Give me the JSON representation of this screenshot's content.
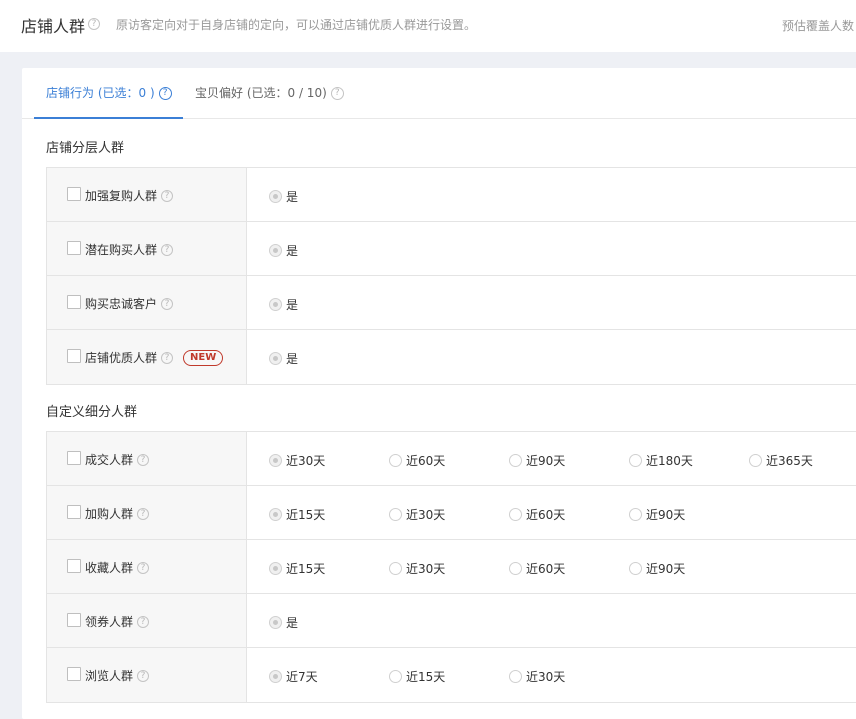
{
  "header": {
    "title": "店铺人群",
    "description": "原访客定向对于自身店铺的定向，可以通过店铺优质人群进行设置。",
    "right_text": "预估覆盖人数"
  },
  "tabs": [
    {
      "label": "店铺行为 (已选：0 )",
      "active": true
    },
    {
      "label": "宝贝偏好 (已选：0 / 10)",
      "active": false
    }
  ],
  "section1": {
    "title": "店铺分层人群",
    "rows": [
      {
        "label": "加强复购人群",
        "badge": "",
        "options": [
          "是"
        ]
      },
      {
        "label": "潜在购买人群",
        "badge": "",
        "options": [
          "是"
        ]
      },
      {
        "label": "购买忠诚客户",
        "badge": "",
        "options": [
          "是"
        ]
      },
      {
        "label": "店铺优质人群",
        "badge": "NEW",
        "options": [
          "是"
        ]
      }
    ]
  },
  "section2": {
    "title": "自定义细分人群",
    "rows": [
      {
        "label": "成交人群",
        "options": [
          "近30天",
          "近60天",
          "近90天",
          "近180天",
          "近365天"
        ]
      },
      {
        "label": "加购人群",
        "options": [
          "近15天",
          "近30天",
          "近60天",
          "近90天"
        ]
      },
      {
        "label": "收藏人群",
        "options": [
          "近15天",
          "近30天",
          "近60天",
          "近90天"
        ]
      },
      {
        "label": "领券人群",
        "options": [
          "是"
        ]
      },
      {
        "label": "浏览人群",
        "options": [
          "近7天",
          "近15天",
          "近30天"
        ]
      }
    ]
  },
  "icons": {
    "help": "question-circle-icon",
    "checkbox": "checkbox-icon",
    "radio": "radio-icon"
  },
  "colors": {
    "accent": "#3b7fd6",
    "badge": "#c0392b",
    "label_bg": "#f7f7f7",
    "page_bg": "#eef0f5"
  }
}
